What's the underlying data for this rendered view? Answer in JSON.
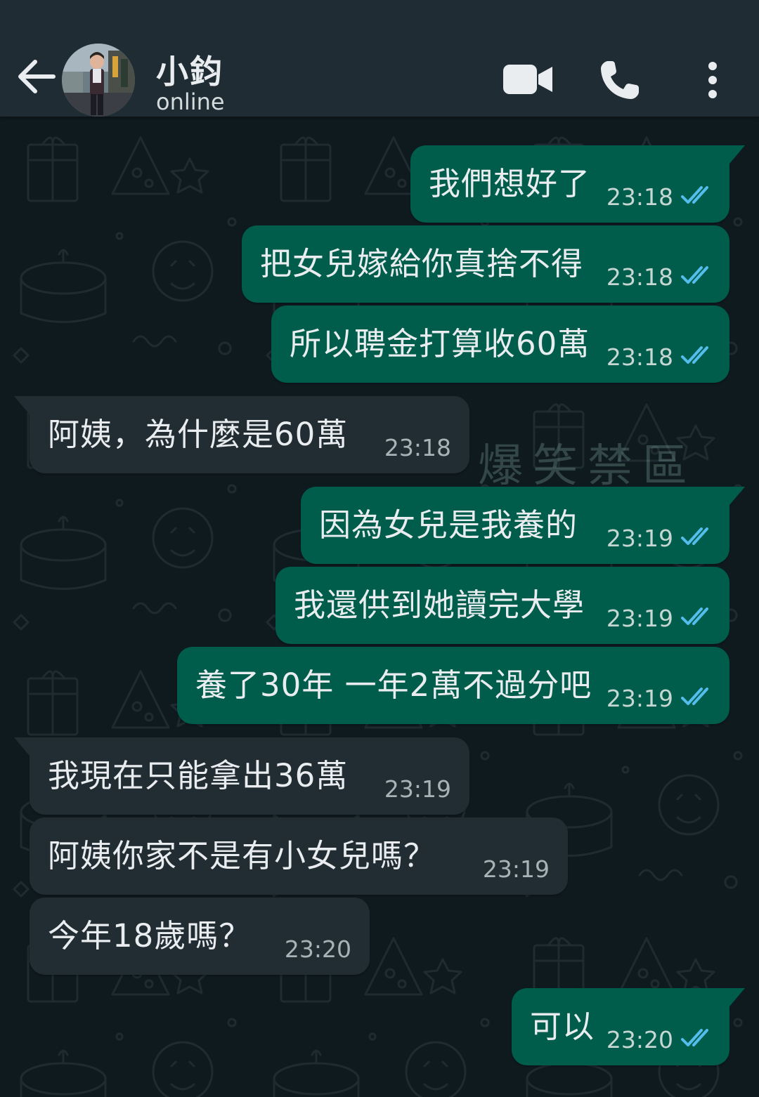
{
  "header": {
    "contact_name": "小鈞",
    "status": "online"
  },
  "messages": [
    {
      "direction": "out",
      "text": "我們想好了",
      "time": "23:18",
      "read": true
    },
    {
      "direction": "out",
      "text": "把女兒嫁給你真捨不得",
      "time": "23:18",
      "read": true
    },
    {
      "direction": "out",
      "text": "所以聘金打算收60萬",
      "time": "23:18",
      "read": true
    },
    {
      "direction": "in",
      "text": "阿姨，為什麼是60萬",
      "time": "23:18"
    },
    {
      "direction": "out",
      "text": "因為女兒是我養的",
      "time": "23:19",
      "read": true
    },
    {
      "direction": "out",
      "text": "我還供到她讀完大學",
      "time": "23:19",
      "read": true
    },
    {
      "direction": "out",
      "text": "養了30年 一年2萬不過分吧",
      "time": "23:19",
      "read": true
    },
    {
      "direction": "in",
      "text": "我現在只能拿出36萬",
      "time": "23:19"
    },
    {
      "direction": "in",
      "text": "阿姨你家不是有小女兒嗎？",
      "time": "23:19"
    },
    {
      "direction": "in",
      "text": "今年18歲嗎？",
      "time": "23:20"
    },
    {
      "direction": "out",
      "text": "可以",
      "time": "23:20",
      "read": true
    }
  ],
  "watermark": "爆笑禁區",
  "colors": {
    "header_bg": "#1f2c33",
    "chat_bg": "#0f1a1f",
    "outgoing_bubble": "#005c4b",
    "incoming_bubble": "#222d33",
    "read_tick": "#53bdeb"
  },
  "icons": {
    "back": "arrow-left-icon",
    "video": "video-camera-icon",
    "call": "phone-icon",
    "menu": "more-vertical-icon",
    "read_receipt": "double-check-icon"
  }
}
